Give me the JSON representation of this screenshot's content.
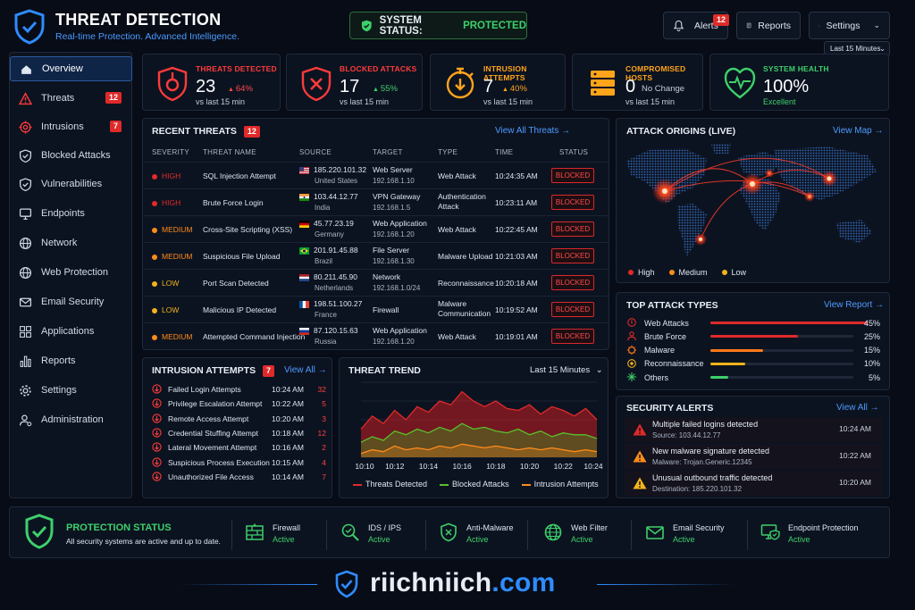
{
  "header": {
    "title": "THREAT DETECTION",
    "subtitle": "Real-time Protection. Advanced Intelligence.",
    "status_prefix": "SYSTEM STATUS:",
    "status_value": "PROTECTED",
    "alerts_label": "Alerts",
    "alerts_count": "12",
    "reports_label": "Reports",
    "settings_label": "Settings",
    "time_range": "Last 15 Minutes"
  },
  "sidebar": {
    "items": [
      {
        "label": "Overview",
        "icon": "home-icon",
        "badge": ""
      },
      {
        "label": "Threats",
        "icon": "warning-icon",
        "badge": "12"
      },
      {
        "label": "Intrusions",
        "icon": "target-icon",
        "badge": "7"
      },
      {
        "label": "Blocked Attacks",
        "icon": "shield-check-icon",
        "badge": ""
      },
      {
        "label": "Vulnerabilities",
        "icon": "shield-check-icon",
        "badge": ""
      },
      {
        "label": "Endpoints",
        "icon": "monitor-icon",
        "badge": ""
      },
      {
        "label": "Network",
        "icon": "globe-icon",
        "badge": ""
      },
      {
        "label": "Web Protection",
        "icon": "globe-icon",
        "badge": ""
      },
      {
        "label": "Email Security",
        "icon": "mail-icon",
        "badge": ""
      },
      {
        "label": "Applications",
        "icon": "grid-icon",
        "badge": ""
      },
      {
        "label": "Reports",
        "icon": "bar-chart-icon",
        "badge": ""
      },
      {
        "label": "Settings",
        "icon": "gear-icon",
        "badge": ""
      },
      {
        "label": "Administration",
        "icon": "user-gear-icon",
        "badge": ""
      }
    ]
  },
  "kpis": [
    {
      "label": "THREATS DETECTED",
      "value": "23",
      "change": "64%",
      "change_dir": "up-bad",
      "sub": "vs last 15 min",
      "color": "#ff3b3b"
    },
    {
      "label": "BLOCKED ATTACKS",
      "value": "17",
      "change": "55%",
      "change_dir": "up-good",
      "sub": "vs last 15 min",
      "color": "#ff3b3b"
    },
    {
      "label": "INTRUSION ATTEMPTS",
      "value": "7",
      "change": "40%",
      "change_dir": "up-warn",
      "sub": "vs last 15 min",
      "color": "#ffa41b"
    },
    {
      "label": "COMPROMISED HOSTS",
      "value": "0",
      "change": "No Change",
      "change_dir": "none",
      "sub": "vs last 15 min",
      "color": "#ffa41b"
    },
    {
      "label": "SYSTEM HEALTH",
      "value": "100%",
      "change": "",
      "change_dir": "none",
      "sub": "Excellent",
      "color": "#3dd06b"
    }
  ],
  "recent_threats": {
    "title": "RECENT THREATS",
    "count": "12",
    "link": "View All Threats",
    "columns": [
      "SEVERITY",
      "THREAT NAME",
      "SOURCE",
      "TARGET",
      "TYPE",
      "TIME",
      "STATUS"
    ],
    "rows": [
      {
        "severity": "HIGH",
        "name": "SQL Injection Attempt",
        "ip": "185.220.101.32",
        "country": "United States",
        "target": "Web Server",
        "target_ip": "192.168.1.10",
        "type": "Web Attack",
        "time": "10:24:35 AM",
        "status": "BLOCKED"
      },
      {
        "severity": "HIGH",
        "name": "Brute Force Login",
        "ip": "103.44.12.77",
        "country": "India",
        "target": "VPN Gateway",
        "target_ip": "192.168.1.5",
        "type": "Authentication Attack",
        "time": "10:23:11 AM",
        "status": "BLOCKED"
      },
      {
        "severity": "MEDIUM",
        "name": "Cross-Site Scripting (XSS)",
        "ip": "45.77.23.19",
        "country": "Germany",
        "target": "Web Application",
        "target_ip": "192.168.1.20",
        "type": "Web Attack",
        "time": "10:22:45 AM",
        "status": "BLOCKED"
      },
      {
        "severity": "MEDIUM",
        "name": "Suspicious File Upload",
        "ip": "201.91.45.88",
        "country": "Brazil",
        "target": "File Server",
        "target_ip": "192.168.1.30",
        "type": "Malware Upload",
        "time": "10:21:03 AM",
        "status": "BLOCKED"
      },
      {
        "severity": "LOW",
        "name": "Port Scan Detected",
        "ip": "80.211.45.90",
        "country": "Netherlands",
        "target": "Network",
        "target_ip": "192.168.1.0/24",
        "type": "Reconnaissance",
        "time": "10:20:18 AM",
        "status": "BLOCKED"
      },
      {
        "severity": "LOW",
        "name": "Malicious IP Detected",
        "ip": "198.51.100.27",
        "country": "France",
        "target": "Firewall",
        "target_ip": "",
        "type": "Malware Communication",
        "time": "10:19:52 AM",
        "status": "BLOCKED"
      },
      {
        "severity": "MEDIUM",
        "name": "Attempted Command Injection",
        "ip": "87.120.15.63",
        "country": "Russia",
        "target": "Web Application",
        "target_ip": "192.168.1.20",
        "type": "Web Attack",
        "time": "10:19:01 AM",
        "status": "BLOCKED"
      }
    ]
  },
  "attack_origins": {
    "title": "ATTACK ORIGINS (LIVE)",
    "link": "View Map",
    "legend": [
      "High",
      "Medium",
      "Low"
    ]
  },
  "top_attack_types": {
    "title": "TOP ATTACK TYPES",
    "link": "View Report",
    "items": [
      {
        "name": "Web Attacks",
        "pct": 45,
        "label": "45%",
        "color": "#e02a2a"
      },
      {
        "name": "Brute Force",
        "pct": 25,
        "label": "25%",
        "color": "#e02a2a"
      },
      {
        "name": "Malware",
        "pct": 15,
        "label": "15%",
        "color": "#ff7a1a"
      },
      {
        "name": "Reconnaissance",
        "pct": 10,
        "label": "10%",
        "color": "#f2b31b"
      },
      {
        "name": "Others",
        "pct": 5,
        "label": "5%",
        "color": "#3dd06b"
      }
    ]
  },
  "intrusion_attempts": {
    "title": "INTRUSION ATTEMPTS",
    "count": "7",
    "link": "View All",
    "rows": [
      {
        "name": "Failed Login Attempts",
        "time": "10:24 AM",
        "count": "32"
      },
      {
        "name": "Privilege Escalation Attempt",
        "time": "10:22 AM",
        "count": "5"
      },
      {
        "name": "Remote Access Attempt",
        "time": "10:20 AM",
        "count": "3"
      },
      {
        "name": "Credential Stuffing Attempt",
        "time": "10:18 AM",
        "count": "12"
      },
      {
        "name": "Lateral Movement Attempt",
        "time": "10:16 AM",
        "count": "2"
      },
      {
        "name": "Suspicious Process Execution",
        "time": "10:15 AM",
        "count": "4"
      },
      {
        "name": "Unauthorized File Access",
        "time": "10:14 AM",
        "count": "7"
      }
    ]
  },
  "threat_trend": {
    "title": "THREAT TREND",
    "range": "Last 15 Minutes"
  },
  "chart_data": {
    "type": "area",
    "x": [
      "10:10",
      "10:12",
      "10:14",
      "10:16",
      "10:18",
      "10:20",
      "10:22",
      "10:24"
    ],
    "series": [
      {
        "name": "Threats Detected",
        "color": "#e02a2a",
        "values": [
          15,
          22,
          18,
          25,
          20,
          27,
          24,
          30,
          28,
          35,
          30,
          27,
          30,
          26,
          25,
          28,
          23,
          27,
          25,
          22,
          26,
          20
        ]
      },
      {
        "name": "Blocked Attacks",
        "color": "#5bbf2a",
        "values": [
          8,
          11,
          9,
          14,
          12,
          15,
          13,
          16,
          14,
          18,
          15,
          16,
          14,
          13,
          15,
          12,
          14,
          11,
          13,
          12,
          12,
          10
        ]
      },
      {
        "name": "Intrusion Attempts",
        "color": "#ff8c1a",
        "values": [
          2,
          4,
          3,
          6,
          4,
          5,
          4,
          6,
          5,
          7,
          6,
          5,
          6,
          5,
          4,
          5,
          4,
          5,
          4,
          3,
          4,
          3
        ]
      }
    ],
    "ylim": [
      0,
      40
    ]
  },
  "security_alerts": {
    "title": "SECURITY ALERTS",
    "link": "View All",
    "rows": [
      {
        "title": "Multiple failed logins detected",
        "sub": "Source: 103.44.12.77",
        "time": "10:24 AM",
        "color": "#e02a2a"
      },
      {
        "title": "New malware signature detected",
        "sub": "Malware: Trojan.Generic.12345",
        "time": "10:22 AM",
        "color": "#ff8c1a"
      },
      {
        "title": "Unusual outbound traffic detected",
        "sub": "Destination: 185.220.101.32",
        "time": "10:20 AM",
        "color": "#f2b31b"
      }
    ]
  },
  "protection": {
    "title": "PROTECTION STATUS",
    "subtitle": "All security systems are active and up to date.",
    "items": [
      {
        "name": "Firewall",
        "status": "Active",
        "icon": "firewall-icon"
      },
      {
        "name": "IDS / IPS",
        "status": "Active",
        "icon": "search-shield-icon"
      },
      {
        "name": "Anti-Malware",
        "status": "Active",
        "icon": "shield-x-icon"
      },
      {
        "name": "Web Filter",
        "status": "Active",
        "icon": "globe-icon"
      },
      {
        "name": "Email Security",
        "status": "Active",
        "icon": "mail-icon"
      },
      {
        "name": "Endpoint Protection",
        "status": "Active",
        "icon": "monitor-shield-icon"
      }
    ]
  },
  "footer": {
    "brand_a": "riichniich",
    "brand_b": ".com"
  }
}
